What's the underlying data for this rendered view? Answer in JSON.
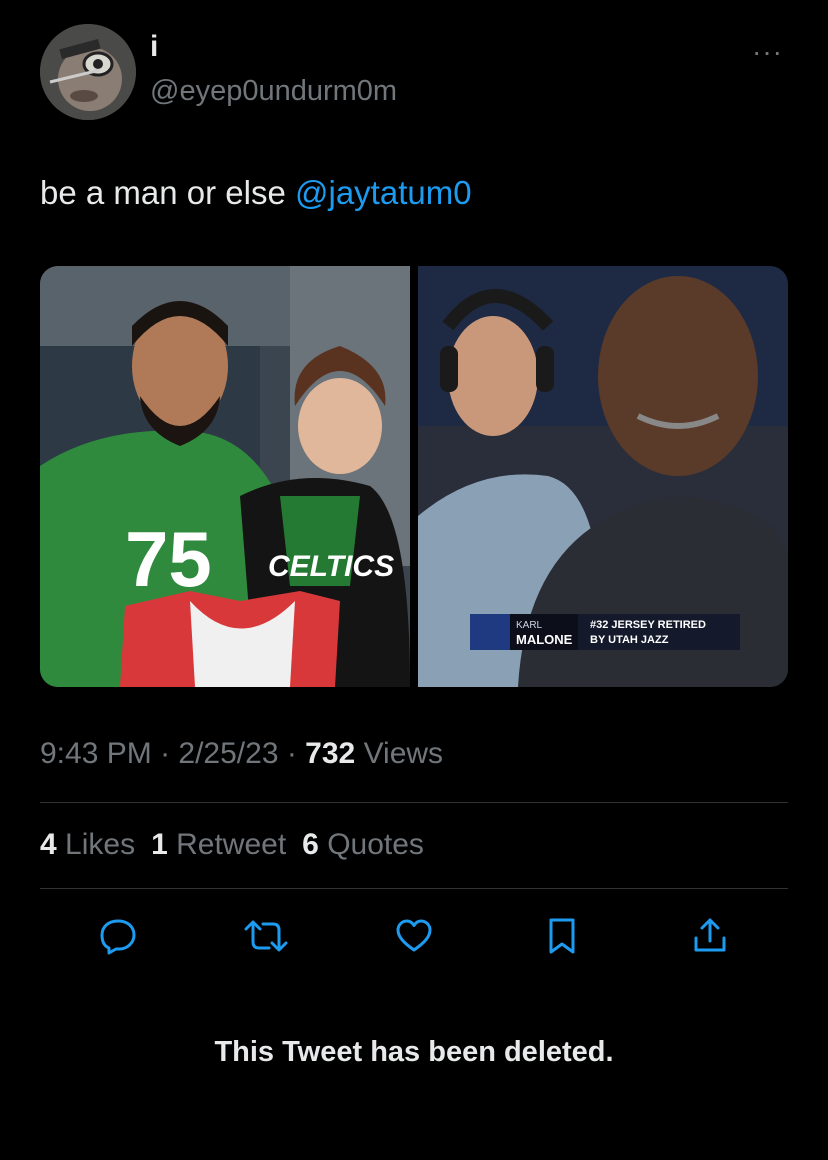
{
  "user": {
    "display_name": "i",
    "handle": "@eyep0undurm0m",
    "more_label": "···"
  },
  "tweet": {
    "text_prefix": "be a man or else ",
    "mention": "@jaytatum0"
  },
  "media": {
    "left": {
      "jersey_number": "75",
      "shirt_text": "CELTICS"
    },
    "right": {
      "lower_third_name_top": "KARL",
      "lower_third_name_bottom": "MALONE",
      "lower_third_caption_top": "#32 JERSEY RETIRED",
      "lower_third_caption_bottom": "BY UTAH JAZZ"
    }
  },
  "meta": {
    "time": "9:43 PM",
    "sep1": " · ",
    "date": "2/25/23",
    "sep2": " · ",
    "views_count": "732",
    "views_label": " Views"
  },
  "stats": {
    "likes_count": "4",
    "likes_label": "Likes",
    "retweets_count": "1",
    "retweets_label": "Retweet",
    "quotes_count": "6",
    "quotes_label": "Quotes"
  },
  "actions": [
    "reply-icon",
    "retweet-icon",
    "like-icon",
    "bookmark-icon",
    "share-icon"
  ],
  "deleted_notice": "This Tweet has been deleted.",
  "colors": {
    "background": "#000000",
    "text": "#e7e9ea",
    "secondary": "#71767b",
    "link": "#1d9bf0",
    "divider": "#2f3336"
  }
}
